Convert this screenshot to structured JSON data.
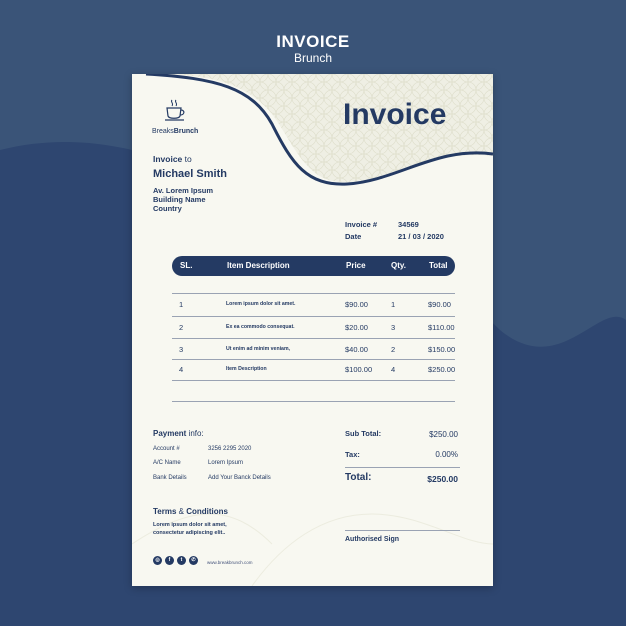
{
  "header": {
    "title": "INVOICE",
    "subtitle": "Brunch"
  },
  "colors": {
    "background": "#3a5478",
    "navy": "#243a63",
    "paper": "#f8f8f1"
  },
  "logo": {
    "icon": "coffee-cup-icon",
    "brand_light": "Breaks",
    "brand_bold": "Brunch"
  },
  "invoice": {
    "title": "Invoice",
    "to_label_bold": "Invoice",
    "to_label_rest": " to",
    "client_name": "Michael Smith",
    "address": [
      "Av. Lorem Ipsum",
      "Building Name",
      "Country"
    ],
    "number_label": "Invoice #",
    "number_value": "34569",
    "date_label": "Date",
    "date_value": "21 / 03 / 2020"
  },
  "table": {
    "headers": [
      "SL.",
      "Item Description",
      "Price",
      "Qty.",
      "Total"
    ],
    "rows": [
      {
        "sl": "1",
        "desc": "Lorem ipsum dolor sit amet.",
        "price": "$90.00",
        "qty": "1",
        "total": "$90.00"
      },
      {
        "sl": "2",
        "desc": "Ex ea commodo consequat.",
        "price": "$20.00",
        "qty": "3",
        "total": "$110.00"
      },
      {
        "sl": "3",
        "desc": "Ut enim ad minim veniam,",
        "price": "$40.00",
        "qty": "2",
        "total": "$150.00"
      },
      {
        "sl": "4",
        "desc": "Item Description",
        "price": "$100.00",
        "qty": "4",
        "total": "$250.00"
      }
    ]
  },
  "payment": {
    "title_bold": "Payment",
    "title_rest": " info:",
    "account_label": "Account #",
    "account_value": "3256 2295 2020",
    "name_label": "A/C Name",
    "name_value": "Lorem Ipsum",
    "bank_label": "Bank Details",
    "bank_value": "Add Your Banck Details"
  },
  "summary": {
    "subtotal_label": "Sub Total:",
    "subtotal_value": "$250.00",
    "tax_label": "Tax:",
    "tax_value": "0.00%",
    "total_label": "Total:",
    "total_value": "$250.00"
  },
  "terms": {
    "title_bold": "Terms",
    "title_amp": " & ",
    "title_rest": "Conditions",
    "text": "Lorem ipsum dolor sit amet, consectetur adipiscing elit.."
  },
  "signature": {
    "label": "Authorised Sign"
  },
  "footer": {
    "social": [
      {
        "icon": "instagram-icon",
        "glyph": "◎"
      },
      {
        "icon": "facebook-icon",
        "glyph": "f"
      },
      {
        "icon": "twitter-icon",
        "glyph": "t"
      },
      {
        "icon": "whatsapp-icon",
        "glyph": "✆"
      }
    ],
    "website": "www.breakbrunch.com"
  }
}
